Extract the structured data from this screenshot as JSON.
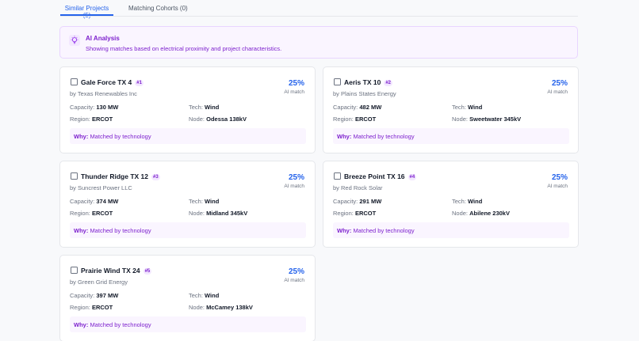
{
  "tabs": [
    {
      "label": "Similar Projects (5)",
      "active": true
    },
    {
      "label": "Matching Cohorts (0)",
      "active": false
    }
  ],
  "ai": {
    "title": "AI Analysis",
    "description": "Showing matches based on electrical proximity and project characteristics.",
    "icon": "lightbulb-icon"
  },
  "labels": {
    "match": "AI match",
    "capacity": "Capacity:",
    "tech": "Tech:",
    "region": "Region:",
    "node": "Node:",
    "why": "Why:"
  },
  "projects": [
    {
      "name": "Gale Force TX 4",
      "rank": "#1",
      "by": "by Texas Renewables Inc",
      "pct": "25%",
      "capacity": "130 MW",
      "tech": "Wind",
      "region": "ERCOT",
      "node": "Odessa 138kV",
      "why": "Matched by technology"
    },
    {
      "name": "Aeris TX 10",
      "rank": "#2",
      "by": "by Plains States Energy",
      "pct": "25%",
      "capacity": "482 MW",
      "tech": "Wind",
      "region": "ERCOT",
      "node": "Sweetwater 345kV",
      "why": "Matched by technology"
    },
    {
      "name": "Thunder Ridge TX 12",
      "rank": "#3",
      "by": "by Suncrest Power LLC",
      "pct": "25%",
      "capacity": "374 MW",
      "tech": "Wind",
      "region": "ERCOT",
      "node": "Midland 345kV",
      "why": "Matched by technology"
    },
    {
      "name": "Breeze Point TX 16",
      "rank": "#4",
      "by": "by Red Rock Solar",
      "pct": "25%",
      "capacity": "291 MW",
      "tech": "Wind",
      "region": "ERCOT",
      "node": "Abilene 230kV",
      "why": "Matched by technology"
    },
    {
      "name": "Prairie Wind TX 24",
      "rank": "#5",
      "by": "by Green Grid Energy",
      "pct": "25%",
      "capacity": "397 MW",
      "tech": "Wind",
      "region": "ERCOT",
      "node": "McCamey 138kV",
      "why": "Matched by technology"
    }
  ]
}
